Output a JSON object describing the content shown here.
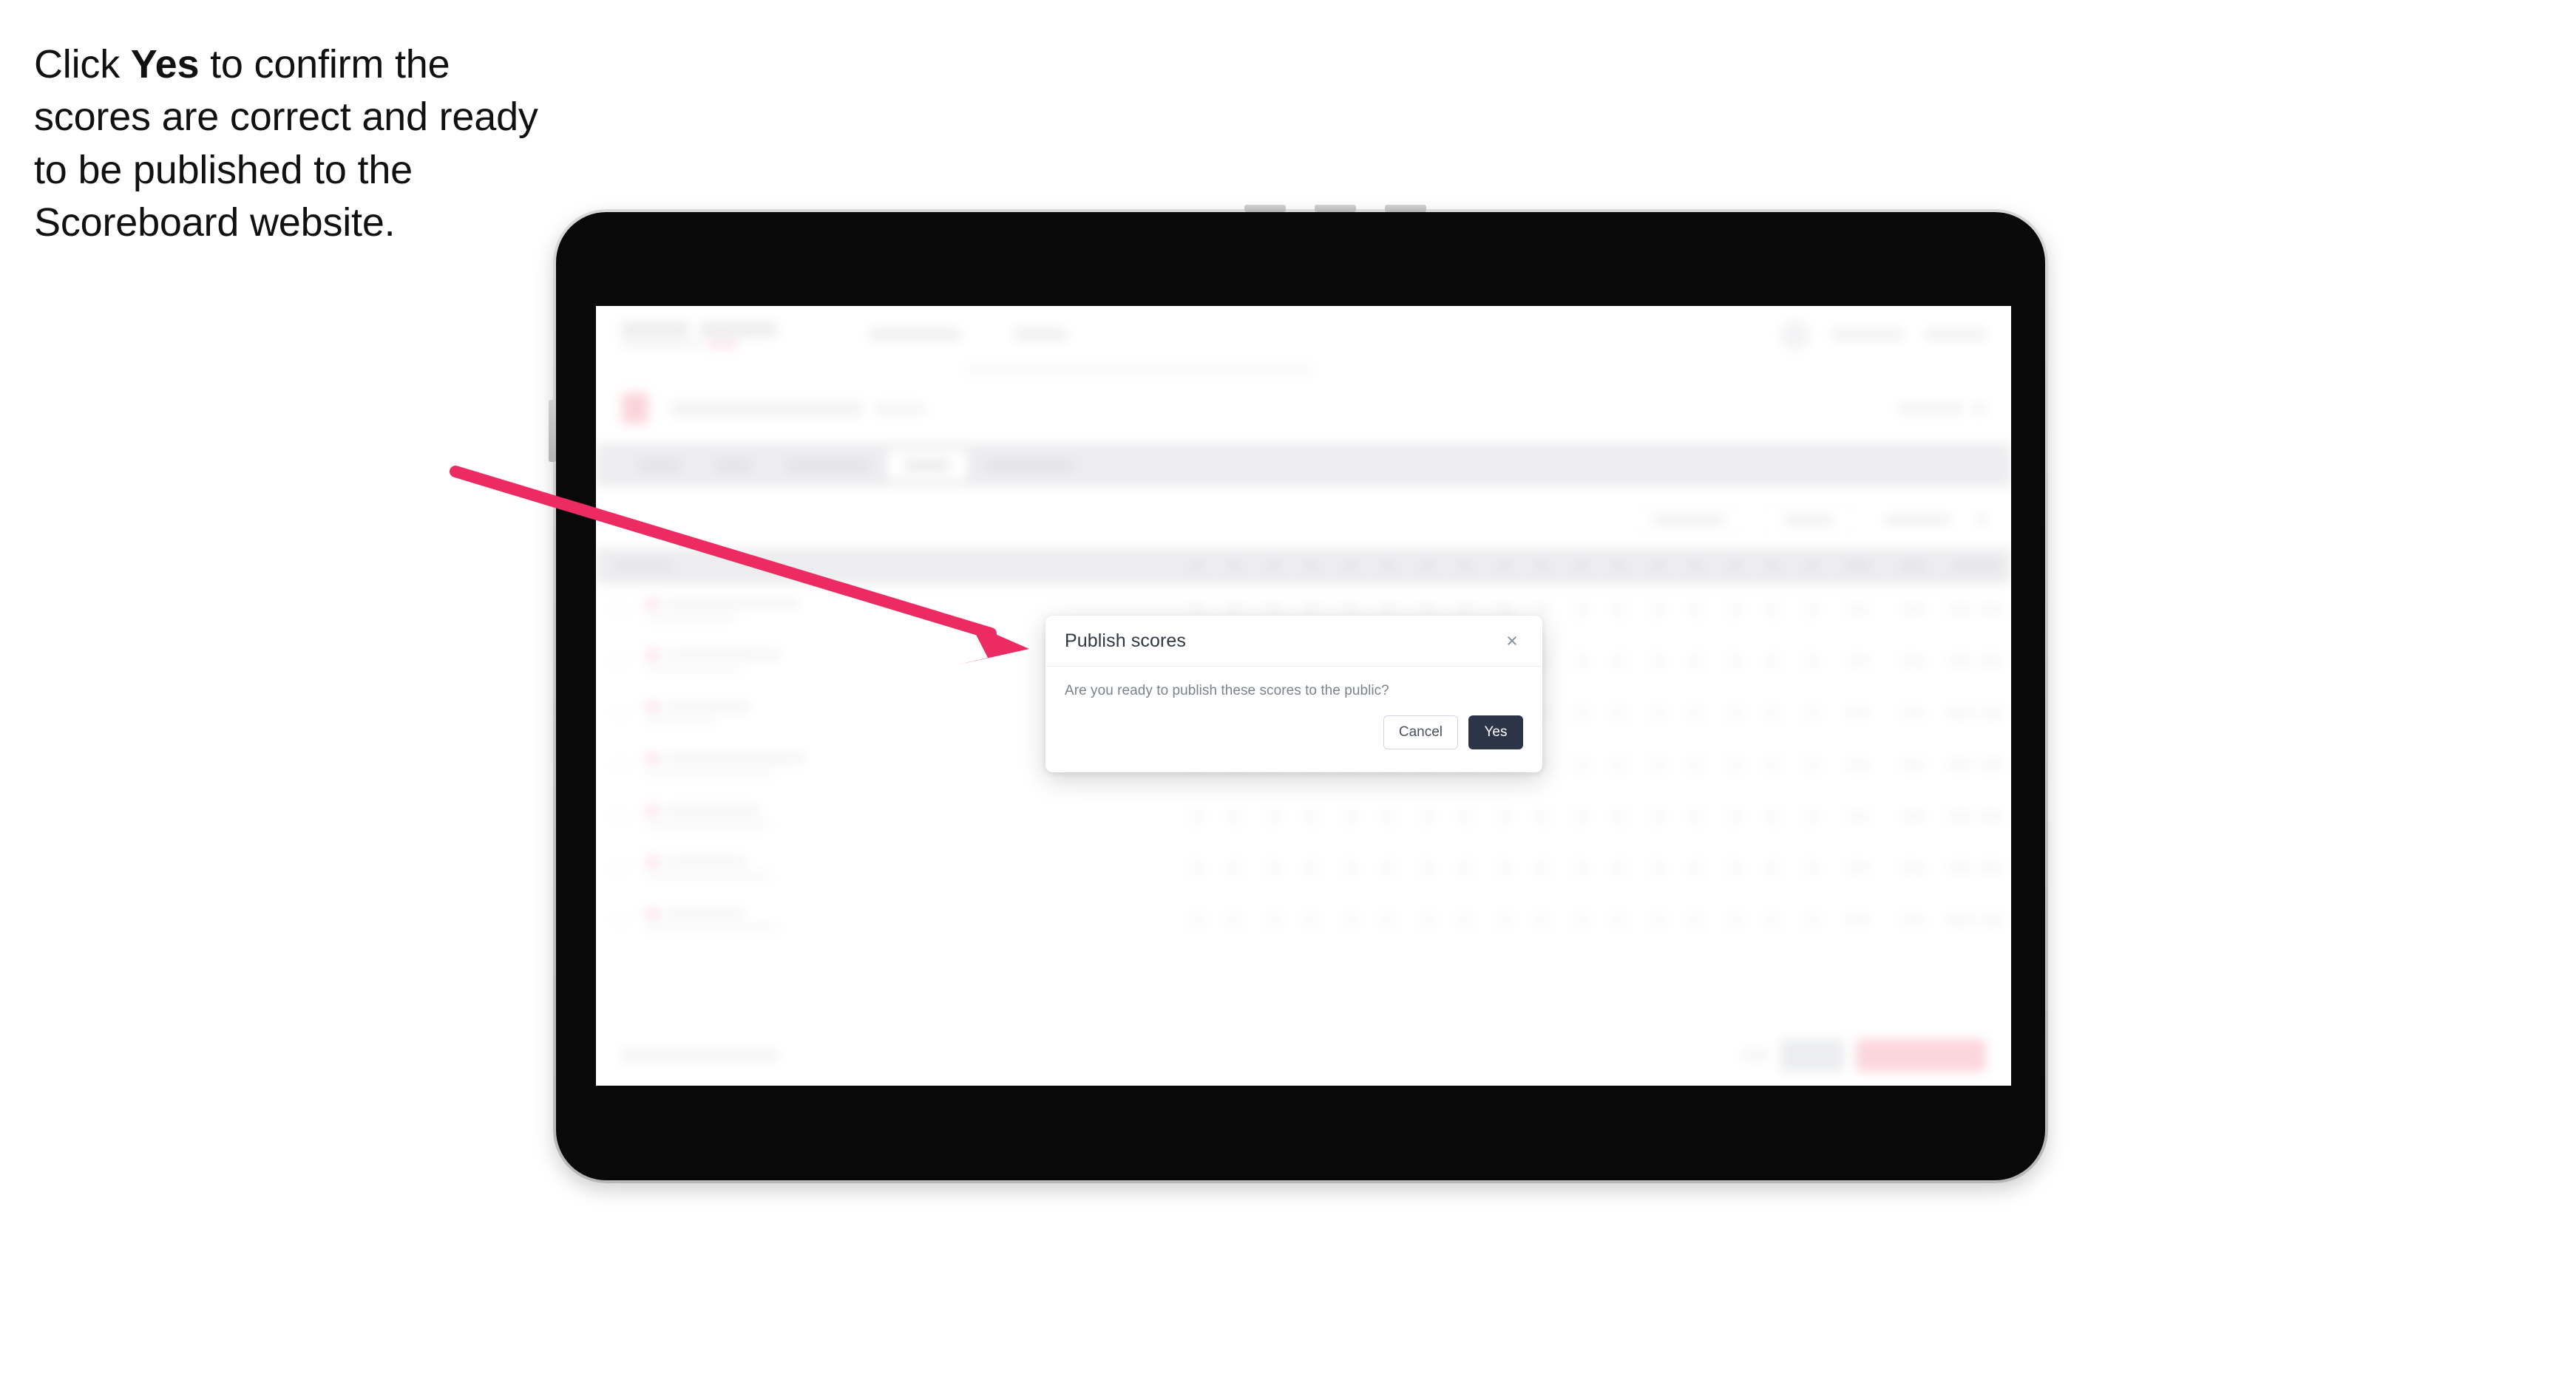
{
  "caption": {
    "before": "Click ",
    "emphasis": "Yes",
    "after": " to confirm the scores are correct and ready to be published to the Scoreboard website."
  },
  "modal": {
    "title": "Publish scores",
    "body_text": "Are you ready to publish these scores to the public?",
    "close_label": "×",
    "cancel_label": "Cancel",
    "confirm_label": "Yes"
  },
  "colors": {
    "arrow": "#ec2b63",
    "confirm_button_bg": "#2b3547",
    "confirm_button_text": "#ffffff",
    "cancel_button_border": "#cfd8e3",
    "cancel_button_text": "#4a515b",
    "modal_title_text": "#2f3741",
    "modal_body_text": "#7b828c",
    "caption_text": "#111111",
    "device_frame": "#c9c9c9",
    "device_screen_bezel": "#090909",
    "app_accent_pink": "#f6a7b6",
    "tabs_bar_bg": "#d7d8dc"
  },
  "device": {
    "type": "tablet",
    "orientation": "landscape"
  },
  "background_app": {
    "note": "blurred behind modal",
    "tabs_count": 5,
    "active_tab_index": 3,
    "table_rows": 7,
    "score_columns": 17
  }
}
